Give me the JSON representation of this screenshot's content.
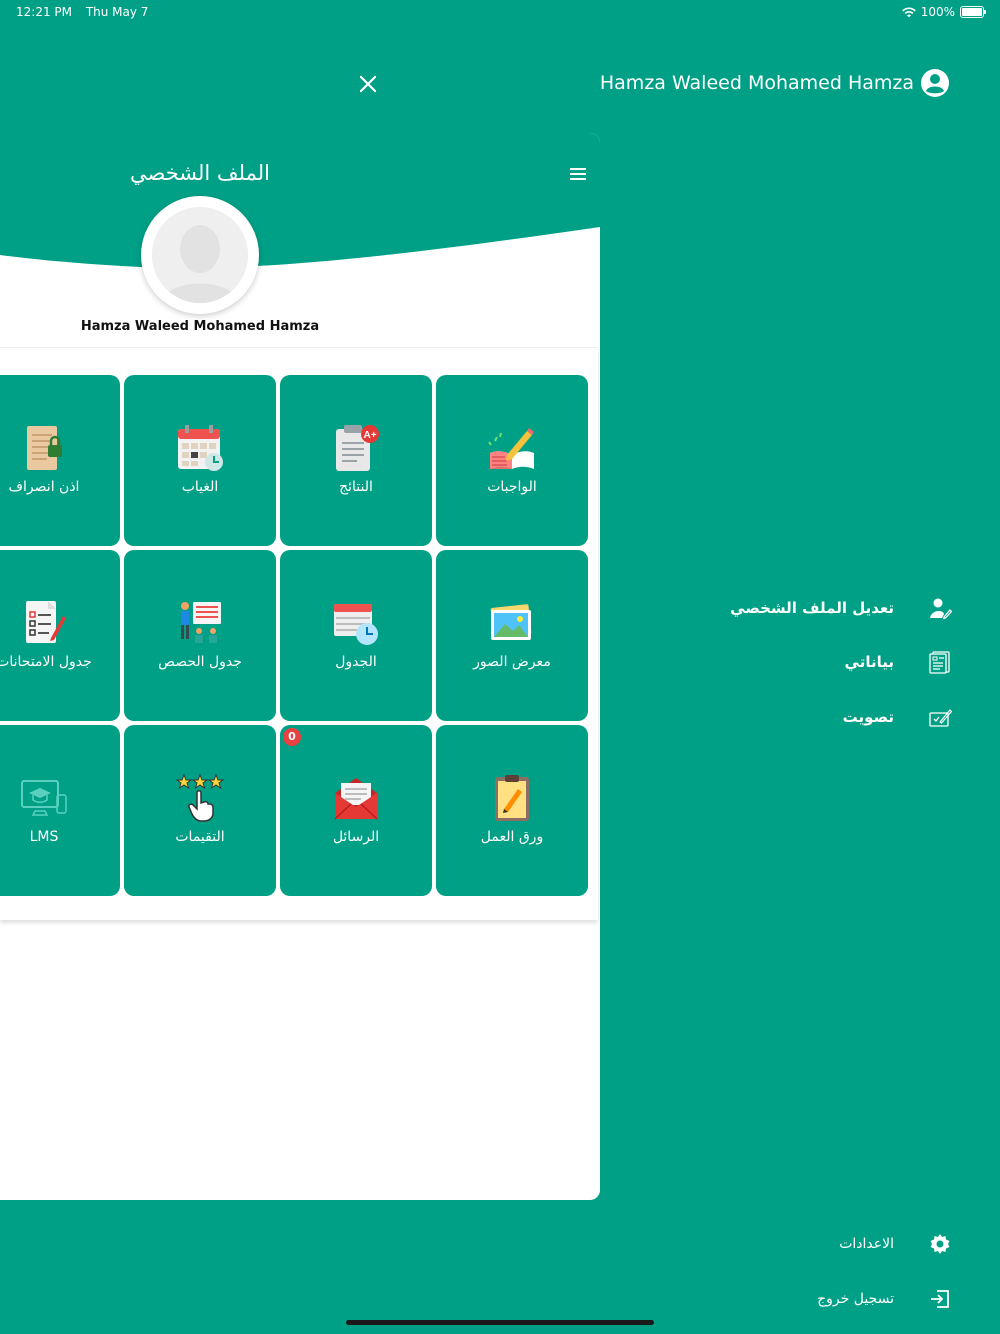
{
  "status_bar": {
    "time": "12:21 PM",
    "date": "Thu May 7",
    "battery": "100%",
    "battery_level": 1.0
  },
  "drawer": {
    "user_name": "Hamza Waleed Mohamed Hamza",
    "menu": [
      {
        "label": "تعديل الملف الشخصي",
        "icon": "edit-profile-icon"
      },
      {
        "label": "بياناتي",
        "icon": "my-data-icon"
      },
      {
        "label": "تصويت",
        "icon": "vote-icon"
      }
    ],
    "bottom": [
      {
        "label": "الاعدادات",
        "icon": "gear-icon"
      },
      {
        "label": "تسجيل خروج",
        "icon": "logout-icon"
      }
    ]
  },
  "panel": {
    "title": "الملف الشخصي",
    "profile_name": "Hamza Waleed Mohamed Hamza",
    "tiles": [
      {
        "label": "الواجبات",
        "icon": "homework-icon"
      },
      {
        "label": "النتائج",
        "icon": "results-icon"
      },
      {
        "label": "الغياب",
        "icon": "absence-icon"
      },
      {
        "label": "اذن انصراف",
        "icon": "leave-permission-icon"
      },
      {
        "label": "معرض الصور",
        "icon": "gallery-icon"
      },
      {
        "label": "الجدول",
        "icon": "schedule-icon"
      },
      {
        "label": "جدول الحصص",
        "icon": "class-schedule-icon"
      },
      {
        "label": "جدول الامتحانات",
        "icon": "exam-schedule-icon"
      },
      {
        "label": "ورق العمل",
        "icon": "worksheet-icon"
      },
      {
        "label": "الرسائل",
        "icon": "messages-icon"
      },
      {
        "label": "التقيمات",
        "icon": "ratings-icon"
      },
      {
        "label": "LMS",
        "icon": "lms-icon"
      }
    ],
    "messages_badge": "0"
  },
  "colors": {
    "primary": "#00a086",
    "badge": "#e84141"
  }
}
